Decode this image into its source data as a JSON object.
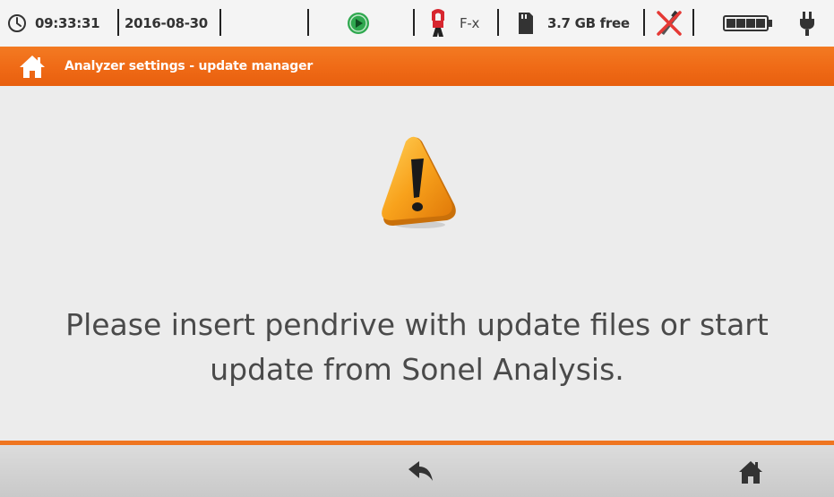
{
  "statusbar": {
    "time": "09:33:31",
    "date": "2016-08-30",
    "clamp_type": "F-x",
    "storage_free": "3.7 GB free",
    "icons": {
      "clock": "clock-icon",
      "record": "record-status-icon",
      "clamp": "current-clamp-icon",
      "sdcard": "sd-card-icon",
      "usb": "usb-disconnected-icon",
      "battery": "battery-icon",
      "power": "power-plug-icon"
    }
  },
  "titlebar": {
    "title": "Analyzer settings - update manager",
    "home_icon": "home-icon"
  },
  "main": {
    "warning_icon": "warning-icon",
    "message_line1": "Please insert pendrive with update files or start",
    "message_line2": "update from Sonel Analysis."
  },
  "bottombar": {
    "back_icon": "back-arrow-icon",
    "home_icon": "home-icon"
  },
  "colors": {
    "accent": "#ef6a16",
    "record_green": "#2fa84f",
    "usb_red": "#e53935"
  }
}
